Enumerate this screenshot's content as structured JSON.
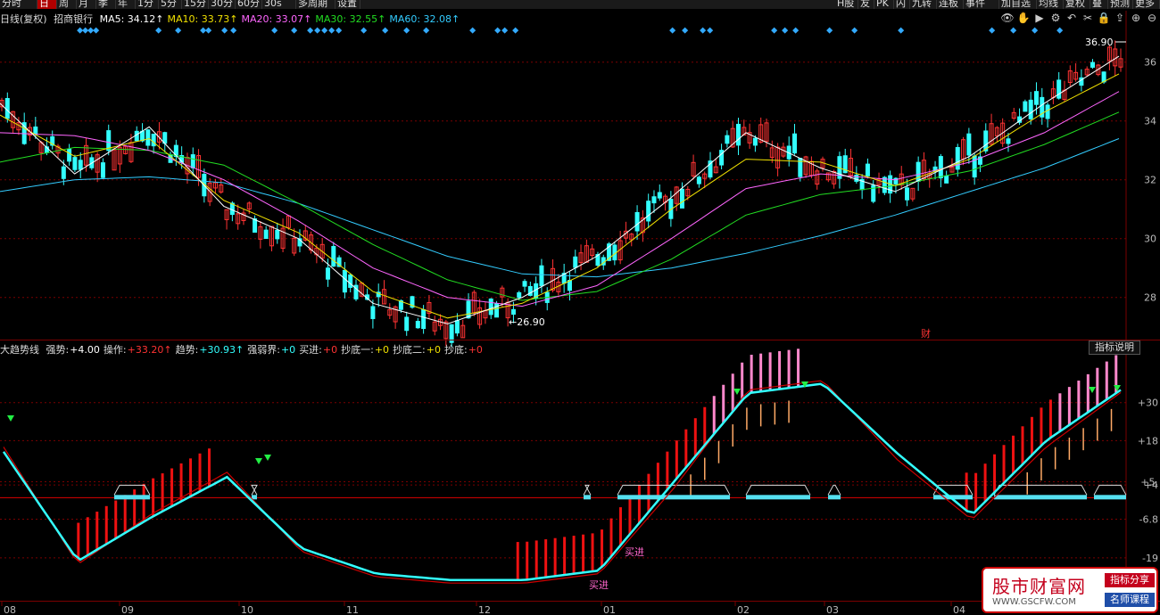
{
  "toolbar": {
    "items": [
      "分时",
      "日",
      "周",
      "月",
      "季",
      "年",
      "1分",
      "5分",
      "15分",
      "30分",
      "60分",
      "30s",
      "多周期",
      "设置"
    ],
    "active_index": 1,
    "right_items": [
      "H股",
      "友",
      "PK",
      "闪",
      "九转",
      "连板",
      "事件",
      "加自选",
      "均线",
      "复权",
      "叠",
      "预测",
      "更多"
    ]
  },
  "main_panel": {
    "title": "日线(复权)",
    "stock_name": "招商银行",
    "ma": [
      {
        "label": "MA5:",
        "value": "34.12↑",
        "color": "#ffffff"
      },
      {
        "label": "MA10:",
        "value": "33.73↑",
        "color": "#f0e000"
      },
      {
        "label": "MA20:",
        "value": "33.07↑",
        "color": "#ff66ff"
      },
      {
        "label": "MA30:",
        "value": "32.55↑",
        "color": "#22dd22"
      },
      {
        "label": "MA60:",
        "value": "32.08↑",
        "color": "#33ccff"
      }
    ],
    "y_ticks": [
      "36",
      "34",
      "32",
      "30",
      "28"
    ],
    "high_label": "36.90",
    "low_label": "←26.90",
    "event_label": "财"
  },
  "tools": [
    "eye-icon",
    "hand-icon",
    "play-icon",
    "gear-icon",
    "undo-icon",
    "scissors-icon",
    "lock-icon",
    "upload-icon",
    "zoom-in-icon",
    "zoom-out-icon"
  ],
  "tool_glyphs": [
    "👁",
    "✋",
    "▶",
    "⚙",
    "↶",
    "✂",
    "🔒",
    "⇪",
    "⊕",
    "⊖"
  ],
  "indicator": {
    "name": "大趋势线",
    "fields": [
      {
        "label": "强势:",
        "value": "+4.00",
        "color": "#ffffff"
      },
      {
        "label": "操作:",
        "value": "+33.20↑",
        "color": "#ff3333"
      },
      {
        "label": "趋势:",
        "value": "+30.93↑",
        "color": "#33ffff"
      },
      {
        "label": "强弱界:",
        "value": "+0",
        "color": "#33ffff"
      },
      {
        "label": "买进:",
        "value": "+0",
        "color": "#ff3333"
      },
      {
        "label": "抄底一:",
        "value": "+0",
        "color": "#f0e000"
      },
      {
        "label": "抄底二:",
        "value": "+0",
        "color": "#f0e000"
      },
      {
        "label": "抄底:",
        "value": "+0",
        "color": "#ff3333"
      }
    ],
    "help_button": "指标说明",
    "y_ticks": [
      "+4",
      "+30",
      "+18",
      "+5.",
      "-6.8",
      "-19"
    ],
    "buy_labels": [
      "买进",
      "买进"
    ]
  },
  "x_axis": [
    "08",
    "09",
    "10",
    "11",
    "12",
    "01",
    "02",
    "03",
    "04"
  ],
  "watermark": {
    "title": "股市财富网",
    "url": "WWW.GSCFW.COM",
    "tag1": "指标分享",
    "tag2": "名师课程"
  },
  "chart_data": {
    "type": "line",
    "title": "日线(复权) 招商银行",
    "ylim": [
      26.9,
      36.9
    ],
    "x_labels": [
      "08",
      "09",
      "10",
      "11",
      "12",
      "01",
      "02",
      "03",
      "04"
    ],
    "series": [
      {
        "name": "MA60",
        "color": "#33ccff",
        "values": [
          31.6,
          32.0,
          32.1,
          31.9,
          31.2,
          30.3,
          29.4,
          28.8,
          28.7,
          29.0,
          29.5,
          30.1,
          30.8,
          31.6,
          32.4,
          33.4
        ]
      },
      {
        "name": "MA30",
        "color": "#22dd22",
        "values": [
          32.6,
          33.1,
          33.0,
          32.5,
          31.2,
          29.8,
          28.6,
          27.9,
          28.2,
          29.3,
          30.8,
          31.5,
          31.8,
          32.3,
          33.2,
          34.3
        ]
      },
      {
        "name": "MA20",
        "color": "#ff66ff",
        "values": [
          33.6,
          33.5,
          33.0,
          32.0,
          30.6,
          29.0,
          28.0,
          27.7,
          28.4,
          30.0,
          31.7,
          32.2,
          32.0,
          32.6,
          33.6,
          35.0
        ]
      },
      {
        "name": "MA10",
        "color": "#f0e000",
        "values": [
          34.2,
          32.8,
          33.4,
          31.3,
          30.2,
          28.2,
          27.3,
          27.8,
          29.0,
          31.0,
          32.7,
          32.6,
          31.8,
          32.7,
          34.3,
          35.6
        ]
      },
      {
        "name": "MA5",
        "color": "#ffffff",
        "values": [
          34.6,
          32.2,
          33.8,
          31.1,
          30.0,
          27.8,
          27.1,
          28.0,
          29.4,
          31.4,
          33.6,
          32.4,
          31.6,
          32.8,
          34.6,
          36.2
        ]
      }
    ],
    "indicator_series": [
      {
        "name": "趋势",
        "color": "#33ffff",
        "values": [
          14.5,
          -20.0,
          -6.0,
          6.5,
          -16.0,
          -24.0,
          -26.0,
          -26.0,
          -23.0,
          5.0,
          33.0,
          36.0,
          14.0,
          -5.5,
          18.0,
          34.0
        ]
      },
      {
        "name": "操作",
        "color": "#cc0000",
        "values": [
          16.0,
          -21.0,
          -5.0,
          8.0,
          -17.0,
          -25.0,
          -27.0,
          -27.0,
          -24.0,
          3.0,
          34.0,
          37.0,
          12.0,
          -7.0,
          16.0,
          33.2
        ]
      }
    ],
    "indicator_ylim": [
      -32,
      44
    ]
  }
}
